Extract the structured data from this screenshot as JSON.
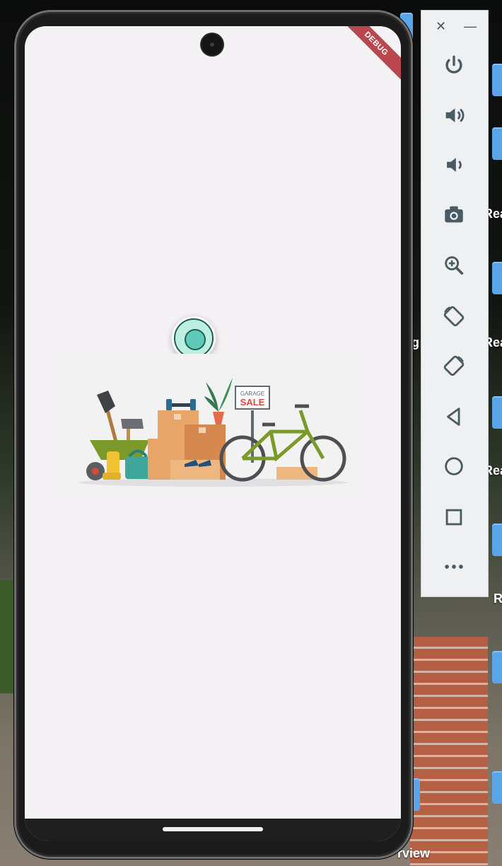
{
  "app": {
    "debug_banner": "DEBUG"
  },
  "desktop": {
    "label_fragment_1": "Rea",
    "label_fragment_2": "Rea",
    "label_fragment_3": "Rea",
    "label_fragment_4": "R",
    "label_fragment_5": "g",
    "label_fragment_6": "rview"
  },
  "emulator_panel": {
    "close": "✕",
    "minimize": "—",
    "buttons": [
      {
        "id": "power",
        "icon": "power-icon"
      },
      {
        "id": "volume-up",
        "icon": "volume-up-icon"
      },
      {
        "id": "volume-down",
        "icon": "volume-down-icon"
      },
      {
        "id": "screenshot",
        "icon": "camera-icon"
      },
      {
        "id": "zoom",
        "icon": "zoom-in-icon"
      },
      {
        "id": "rotate-left",
        "icon": "rotate-left-icon"
      },
      {
        "id": "rotate-right",
        "icon": "rotate-right-icon"
      },
      {
        "id": "back",
        "icon": "back-triangle-icon"
      },
      {
        "id": "home",
        "icon": "home-circle-icon"
      },
      {
        "id": "overview",
        "icon": "overview-square-icon"
      },
      {
        "id": "more",
        "icon": "more-dots-icon"
      }
    ]
  },
  "illustration": {
    "sign_line1": "GARAGE",
    "sign_line2": "SALE"
  },
  "colors": {
    "loader_core": "#5fcab7",
    "loader_ring": "#bdeee2",
    "debug_banner": "#b8474e",
    "screen_bg": "#f5f2f5"
  }
}
